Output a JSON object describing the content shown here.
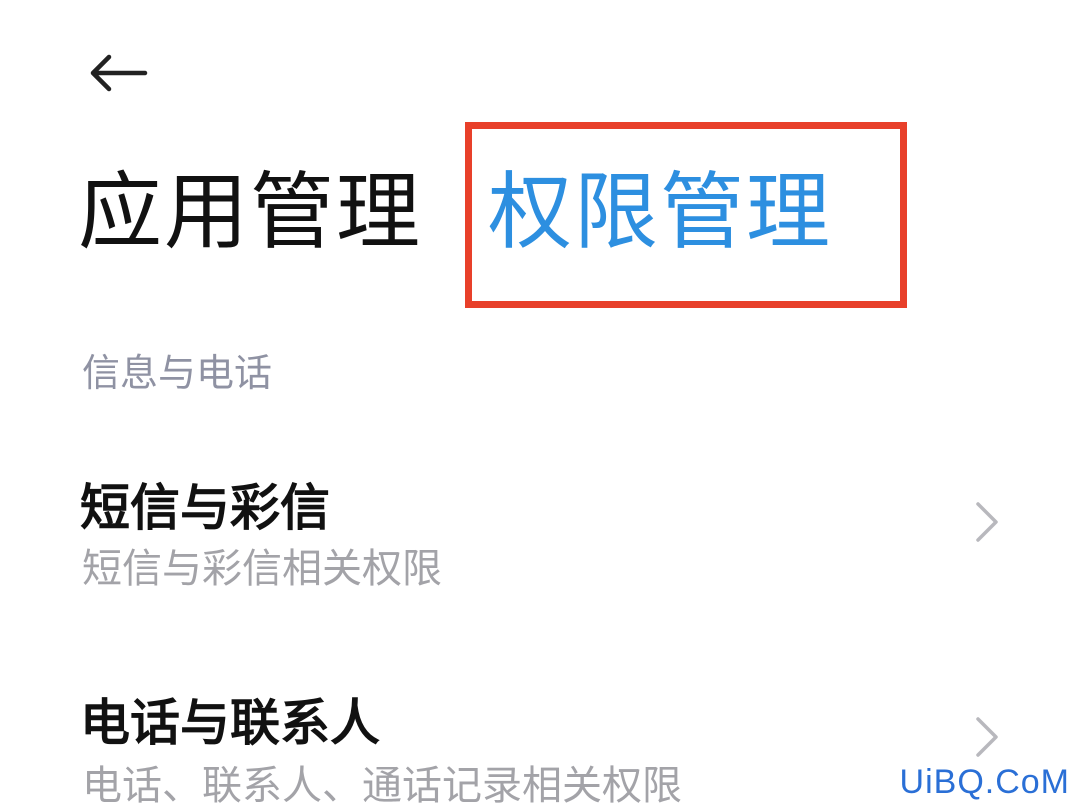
{
  "header": {
    "back_icon": "arrow-left-icon"
  },
  "tabs": [
    {
      "label": "应用管理",
      "active": false
    },
    {
      "label": "权限管理",
      "active": true
    }
  ],
  "colors": {
    "active_tab": "#2d8fe0",
    "highlight_border": "#e8402a",
    "section_header": "#8f92a3",
    "subtitle": "#a3a3a8"
  },
  "section": {
    "title": "信息与电话"
  },
  "items": [
    {
      "title": "短信与彩信",
      "subtitle": "短信与彩信相关权限",
      "icon": "chevron-right-icon"
    },
    {
      "title": "电话与联系人",
      "subtitle": "电话、联系人、通话记录相关权限",
      "icon": "chevron-right-icon"
    }
  ],
  "watermark": "UiBQ.CoM"
}
